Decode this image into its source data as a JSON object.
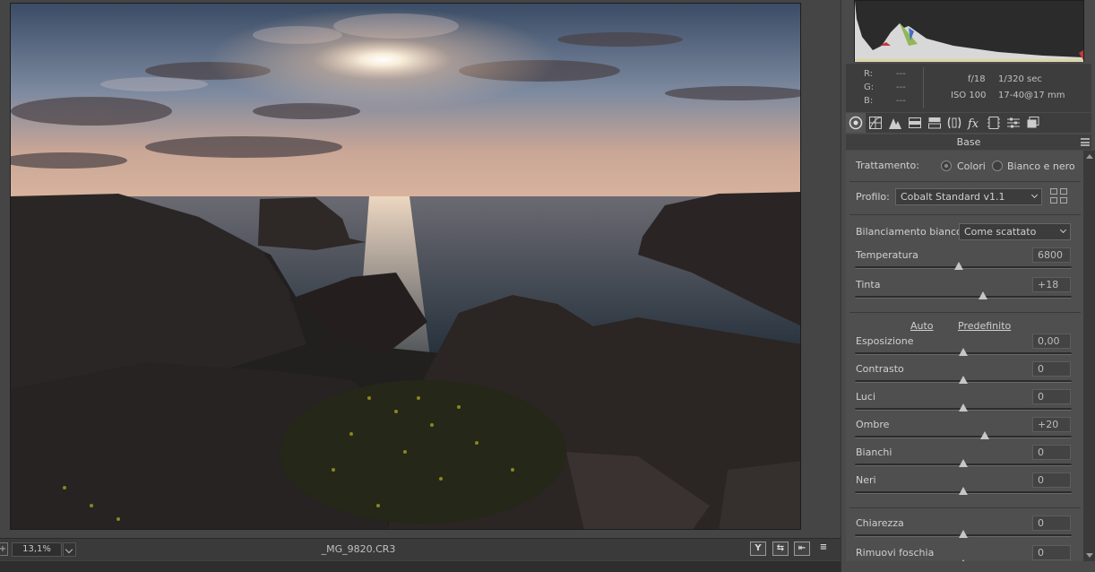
{
  "preview": {
    "zoom": "13,1%",
    "filename": "_MG_9820.CR3",
    "buttons": {
      "y_label": "Y",
      "swap_label": "⇆",
      "copy_label": "⇤",
      "settings_label": "≡"
    }
  },
  "info": {
    "r_label": "R:",
    "g_label": "G:",
    "b_label": "B:",
    "r_value": "---",
    "g_value": "---",
    "b_value": "---",
    "aperture": "f/18",
    "shutter": "1/320 sec",
    "iso": "ISO 100",
    "lens": "17-40@17 mm"
  },
  "tabs": [
    "base-tab",
    "tone-curve-tab",
    "detail-tab",
    "hsl-tab",
    "split-toning-tab",
    "lens-tab",
    "effects-tab",
    "calibration-tab",
    "presets-tab",
    "snapshots-tab"
  ],
  "section": {
    "title": "Base"
  },
  "controls": {
    "treatment_label": "Trattamento:",
    "treatment_color": "Colori",
    "treatment_bw": "Bianco e nero",
    "profile_label": "Profilo:",
    "profile_value": "Cobalt Standard v1.1",
    "wb_label": "Bilanciamento bianco:",
    "wb_value": "Come scattato",
    "auto_link": "Auto",
    "default_link": "Predefinito",
    "sliders": [
      {
        "label": "Temperatura",
        "value": "6800",
        "pos": 0.48
      },
      {
        "label": "Tinta",
        "value": "+18",
        "pos": 0.59
      },
      {
        "label": "Esposizione",
        "value": "0,00",
        "pos": 0.5
      },
      {
        "label": "Contrasto",
        "value": "0",
        "pos": 0.5
      },
      {
        "label": "Luci",
        "value": "0",
        "pos": 0.5
      },
      {
        "label": "Ombre",
        "value": "+20",
        "pos": 0.6
      },
      {
        "label": "Bianchi",
        "value": "0",
        "pos": 0.5
      },
      {
        "label": "Neri",
        "value": "0",
        "pos": 0.5
      },
      {
        "label": "Chiarezza",
        "value": "0",
        "pos": 0.5
      },
      {
        "label": "Rimuovi foschia",
        "value": "0",
        "pos": 0.5
      }
    ]
  },
  "colors": {
    "panel": "#4f4f4f",
    "track": "#2c2c2c",
    "thumb": "#c6c6c6"
  }
}
